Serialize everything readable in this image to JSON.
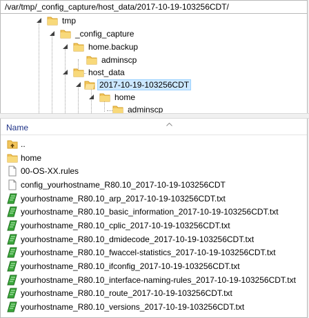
{
  "path": "/var/tmp/_config_capture/host_data/2017-10-19-103256CDT/",
  "tree": {
    "nodes": [
      {
        "label": "tmp",
        "level": 0,
        "expanded": true,
        "selected": false
      },
      {
        "label": "_config_capture",
        "level": 1,
        "expanded": true,
        "selected": false
      },
      {
        "label": "home.backup",
        "level": 2,
        "expanded": true,
        "selected": false
      },
      {
        "label": "adminscp",
        "level": 3,
        "expanded": false,
        "selected": false
      },
      {
        "label": "host_data",
        "level": 2,
        "expanded": true,
        "selected": false
      },
      {
        "label": "2017-10-19-103256CDT",
        "level": 3,
        "expanded": true,
        "selected": true
      },
      {
        "label": "home",
        "level": 4,
        "expanded": true,
        "selected": false
      },
      {
        "label": "adminscp",
        "level": 5,
        "expanded": false,
        "selected": false
      }
    ]
  },
  "file_list": {
    "column_name": "Name",
    "items": [
      {
        "label": "..",
        "icon": "parent-folder-icon"
      },
      {
        "label": "home",
        "icon": "folder-icon"
      },
      {
        "label": "00-OS-XX.rules",
        "icon": "file-icon"
      },
      {
        "label": "config_yourhostname_R80.10_2017-10-19-103256CDT",
        "icon": "file-icon"
      },
      {
        "label": "yourhostname_R80.10_arp_2017-10-19-103256CDT.txt",
        "icon": "text-file-icon"
      },
      {
        "label": "yourhostname_R80.10_basic_information_2017-10-19-103256CDT.txt",
        "icon": "text-file-icon"
      },
      {
        "label": "yourhostname_R80.10_cplic_2017-10-19-103256CDT.txt",
        "icon": "text-file-icon"
      },
      {
        "label": "yourhostname_R80.10_dmidecode_2017-10-19-103256CDT.txt",
        "icon": "text-file-icon"
      },
      {
        "label": "yourhostname_R80.10_fwaccel-statistics_2017-10-19-103256CDT.txt",
        "icon": "text-file-icon"
      },
      {
        "label": "yourhostname_R80.10_ifconfig_2017-10-19-103256CDT.txt",
        "icon": "text-file-icon"
      },
      {
        "label": "yourhostname_R80.10_interface-naming-rules_2017-10-19-103256CDT.txt",
        "icon": "text-file-icon"
      },
      {
        "label": "yourhostname_R80.10_route_2017-10-19-103256CDT.txt",
        "icon": "text-file-icon"
      },
      {
        "label": "yourhostname_R80.10_versions_2017-10-19-103256CDT.txt",
        "icon": "text-file-icon"
      }
    ]
  },
  "colors": {
    "selection_bg": "#cce8ff",
    "selection_border": "#99d1ff",
    "folder": "#f2c55c",
    "header_text": "#1e3287",
    "text_file_green": "#3aa63a"
  }
}
